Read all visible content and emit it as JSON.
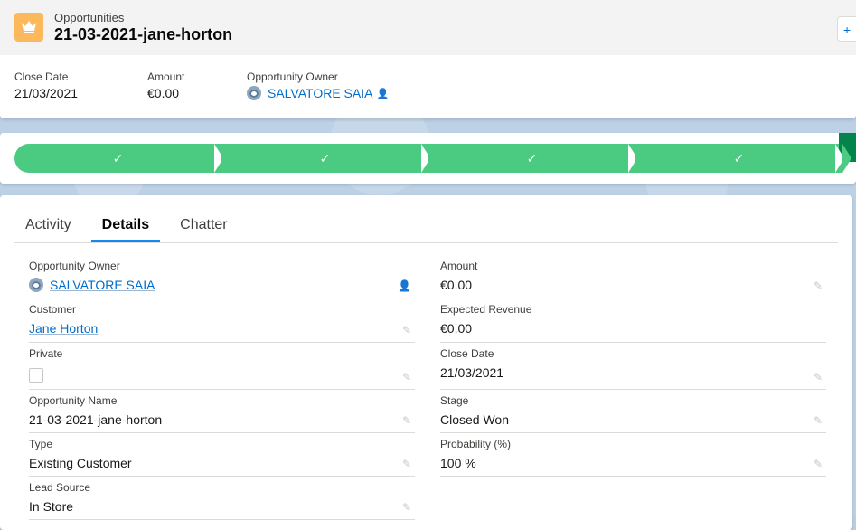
{
  "header": {
    "object_type": "Opportunities",
    "record_title": "21-03-2021-jane-horton",
    "follow_label": "+",
    "highlights": [
      {
        "label": "Close Date",
        "value": "21/03/2021"
      },
      {
        "label": "Amount",
        "value": "€0.00"
      },
      {
        "label": "Opportunity Owner",
        "value": "SALVATORE SAIA"
      }
    ]
  },
  "path": {
    "stages": [
      {
        "icon": "✓"
      },
      {
        "icon": "✓"
      },
      {
        "icon": "✓"
      },
      {
        "icon": "✓"
      }
    ]
  },
  "tabs": [
    "Activity",
    "Details",
    "Chatter"
  ],
  "active_tab": "Details",
  "details": {
    "left": [
      {
        "label": "Opportunity Owner",
        "value": "SALVATORE SAIA"
      },
      {
        "label": "Customer",
        "value": "Jane Horton"
      },
      {
        "label": "Private",
        "value": ""
      },
      {
        "label": "Opportunity Name",
        "value": "21-03-2021-jane-horton"
      },
      {
        "label": "Type",
        "value": "Existing Customer"
      },
      {
        "label": "Lead Source",
        "value": "In Store"
      }
    ],
    "right": [
      {
        "label": "Amount",
        "value": "€0.00"
      },
      {
        "label": "Expected Revenue",
        "value": "€0.00"
      },
      {
        "label": "Close Date",
        "value": "21/03/2021"
      },
      {
        "label": "Stage",
        "value": "Closed Won"
      },
      {
        "label": "Probability (%)",
        "value": "100 %"
      }
    ]
  },
  "colors": {
    "path_complete": "#4bca81",
    "path_current": "#04844b",
    "link": "#006dcc",
    "object_icon": "#fcb95b",
    "tab_underline": "#1589ee"
  }
}
